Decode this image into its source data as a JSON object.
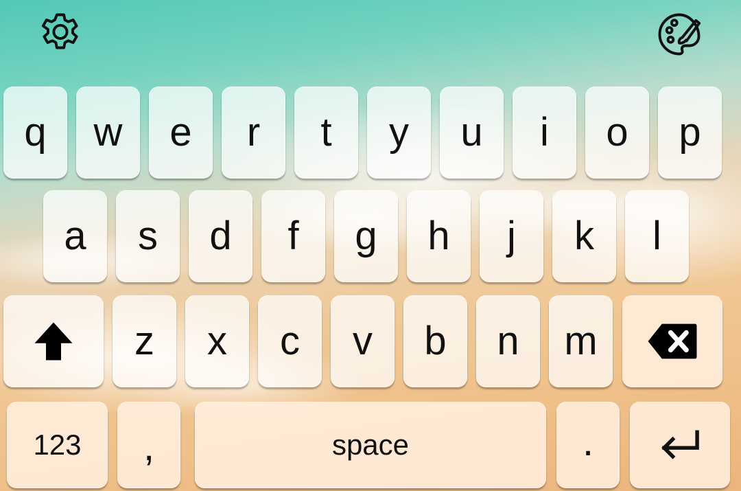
{
  "toolbar": {
    "settings_icon": "gear-icon",
    "theme_icon": "palette-brush-icon"
  },
  "rows": [
    [
      "q",
      "w",
      "e",
      "r",
      "t",
      "y",
      "u",
      "i",
      "o",
      "p"
    ],
    [
      "a",
      "s",
      "d",
      "f",
      "g",
      "h",
      "j",
      "k",
      "l"
    ],
    [
      "z",
      "x",
      "c",
      "v",
      "b",
      "n",
      "m"
    ]
  ],
  "bottom_row": {
    "numbers_label": "123",
    "comma_label": ",",
    "space_label": "space",
    "period_label": ".",
    "enter_icon": "enter-return-icon"
  },
  "special": {
    "shift_icon": "shift-arrow-icon",
    "backspace_icon": "backspace-icon"
  },
  "colors": {
    "key_background": "#ffffffb8",
    "key_text": "#111111",
    "sea": "#52c9b6",
    "sand": "#efc089"
  }
}
